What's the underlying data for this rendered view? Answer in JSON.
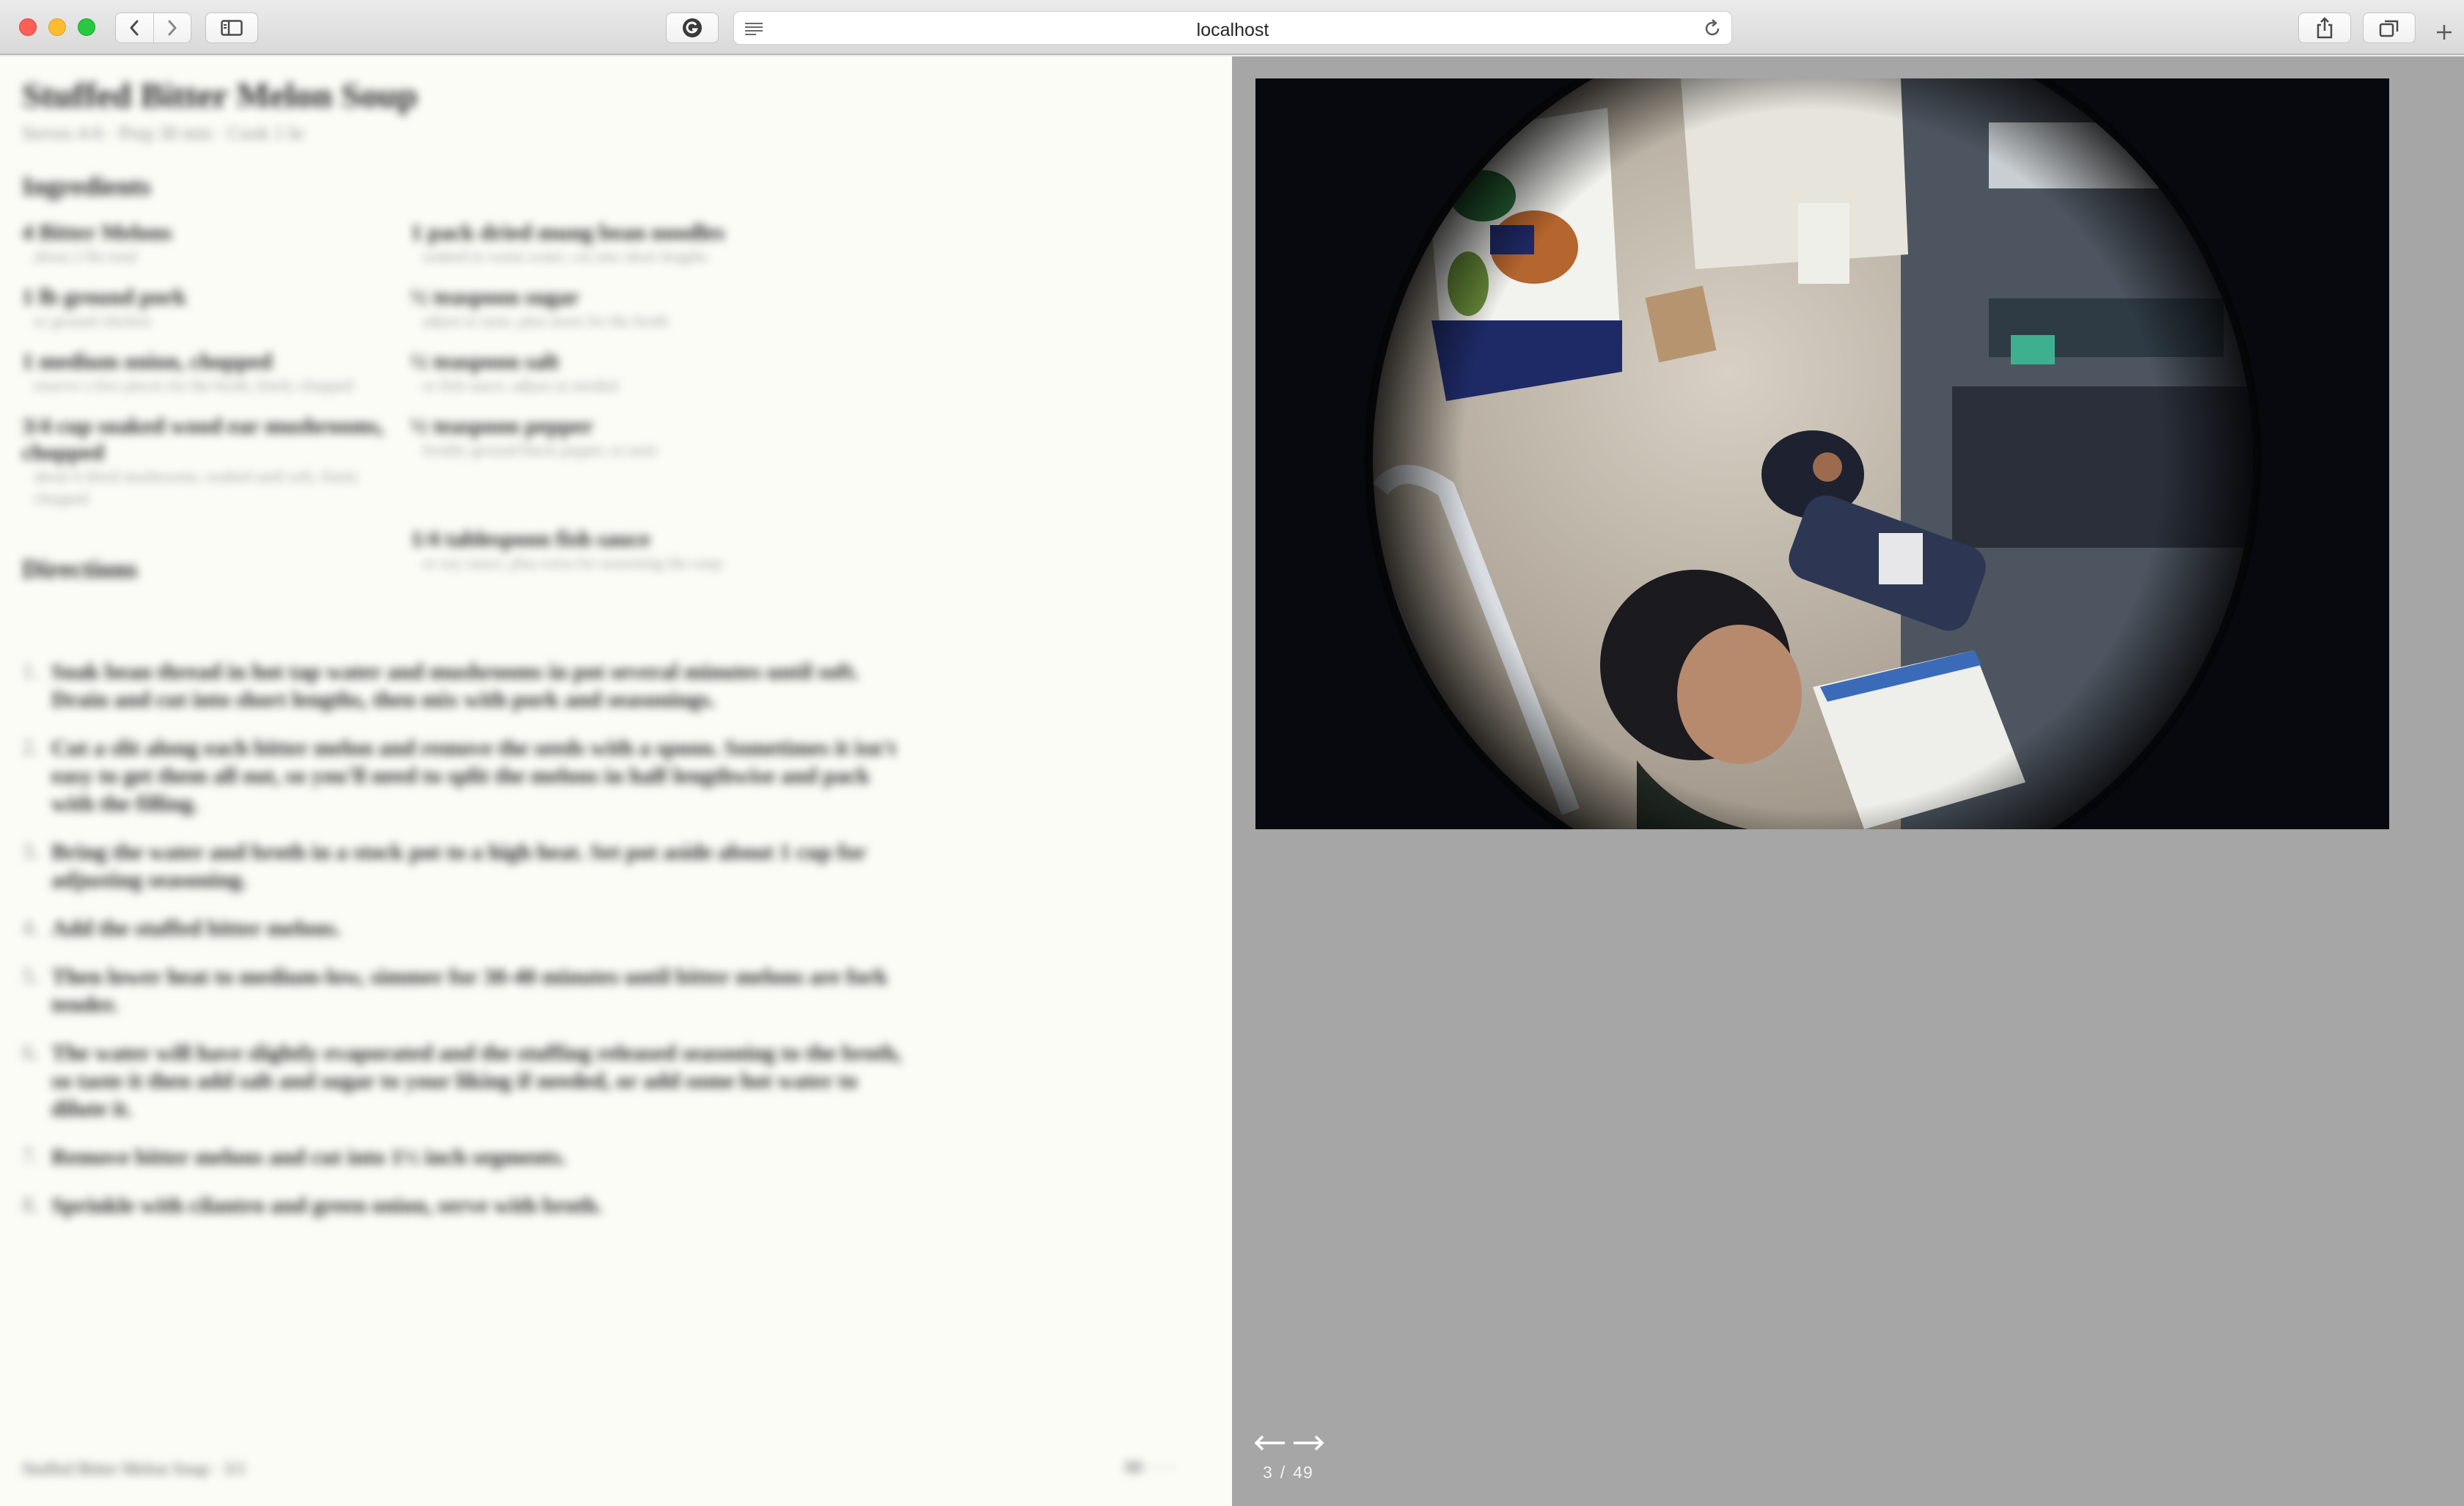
{
  "browser": {
    "url": "localhost",
    "icons": {
      "back": "chevron-left-icon",
      "forward": "chevron-right-icon",
      "sidebar": "sidebar-icon",
      "extension": "grammarly-icon",
      "reader": "reader-view-icon",
      "reload": "reload-icon",
      "share": "share-icon",
      "tabs": "tab-overview-icon",
      "new_tab": "plus-icon"
    }
  },
  "recipe": {
    "title": "Stuffed Bitter Melon Soup",
    "meta": "Serves 4-6 · Prep 30 min · Cook 1 hr",
    "ingredients_heading": "Ingredients",
    "ingredients": [
      {
        "name": "4 Bitter Melons",
        "note": "about 2 lbs total"
      },
      {
        "name": "1 pack dried mung bean noodles",
        "note": "soaked in warm water, cut into short lengths"
      },
      {
        "name": "1 lb ground pork",
        "note": "or ground chicken"
      },
      {
        "name": "½ teaspoon sugar",
        "note": "adjust to taste, plus more for the broth"
      },
      {
        "name": "1 medium onion, chopped",
        "note": "reserve a few pieces for the broth, finely chopped"
      },
      {
        "name": "½ teaspoon salt",
        "note": "or fish sauce, adjust as needed"
      },
      {
        "name": "3/4 cup soaked wood ear mushrooms, chopped",
        "note": "about 6 dried mushrooms, soaked until soft, finely chopped"
      },
      {
        "name": "½ teaspoon pepper",
        "note": "freshly ground black pepper, to taste"
      },
      {
        "name": "",
        "note": ""
      },
      {
        "name": "1/4 tablespoon fish sauce",
        "note": "or soy sauce, plus extra for seasoning the soup"
      }
    ],
    "directions_heading": "Directions",
    "directions": [
      {
        "num": "1.",
        "text": "Soak bean thread in hot tap water and mushrooms in pot several minutes until soft. Drain and cut into short lengths, then mix with pork and seasonings."
      },
      {
        "num": "2.",
        "text": "Cut a slit along each bitter melon and remove the seeds with a spoon. Sometimes it isn't easy to get them all out, so you'll need to split the melons in half lengthwise and pack with the filling."
      },
      {
        "num": "3.",
        "text": "Bring the water and broth in a stock pot to a high heat. Set pot aside about 1 cup for adjusting seasoning."
      },
      {
        "num": "4.",
        "text": "Add the stuffed bitter melons."
      },
      {
        "num": "5.",
        "text": "Then lower heat to medium-low, simmer for 30-40 minutes until bitter melons are fork tender."
      },
      {
        "num": "6.",
        "text": "The water will have slightly evaporated and the stuffing released seasoning to the broth, so taste it then add salt and sugar to your liking if needed, or add some hot water to dilute it."
      },
      {
        "num": "7.",
        "text": "Remove bitter melons and cut into 1½ inch segments."
      },
      {
        "num": "8.",
        "text": "Sprinkle with cilantro and green onion, serve with broth."
      }
    ],
    "footer_left": "Stuffed Bitter Melon Soup · 3/1",
    "footer_right": "88 · · ·"
  },
  "gallery": {
    "photo_alt": "Fisheye photograph of a person in a classroom holding papers",
    "prev_icon": "arrow-left-icon",
    "next_icon": "arrow-right-icon",
    "current": "3",
    "separator": "/",
    "total": "49"
  }
}
